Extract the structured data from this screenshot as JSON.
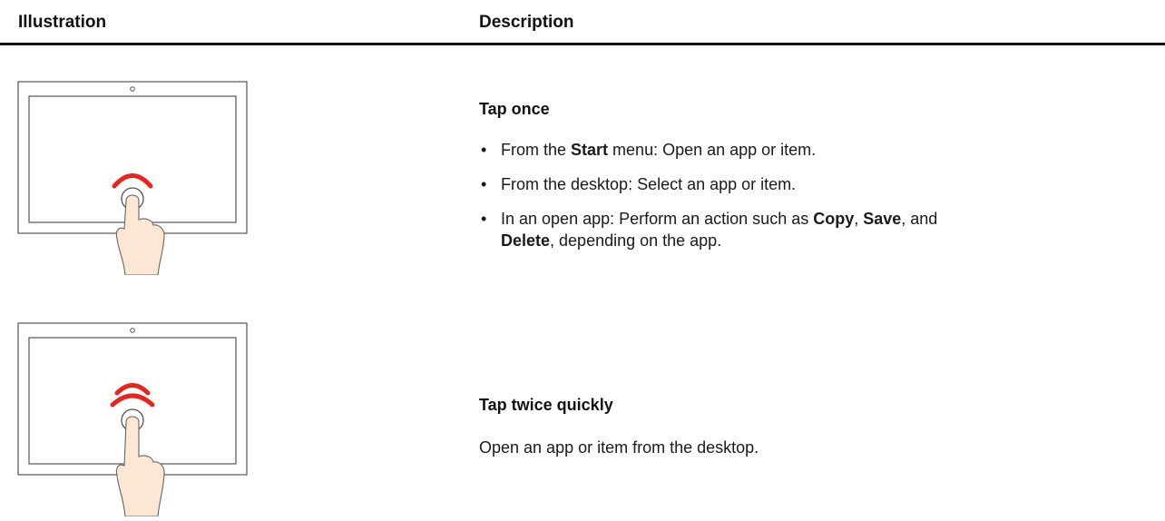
{
  "header": {
    "illustration": "Illustration",
    "description": "Description"
  },
  "colors": {
    "arc": "#e8241c",
    "skin": "#fbe7d4",
    "line": "#555555",
    "rule": "#111111"
  },
  "rows": [
    {
      "title": "Tap once",
      "tap_count": 1,
      "bullets": [
        {
          "parts": [
            {
              "text": "From the "
            },
            {
              "text": "Start",
              "bold": true
            },
            {
              "text": " menu: Open an app or item."
            }
          ]
        },
        {
          "parts": [
            {
              "text": "From the desktop: Select an app or item."
            }
          ]
        },
        {
          "parts": [
            {
              "text": "In an open app: Perform an action such as "
            },
            {
              "text": "Copy",
              "bold": true
            },
            {
              "text": ", "
            },
            {
              "text": "Save",
              "bold": true
            },
            {
              "text": ", and"
            },
            {
              "br": true
            },
            {
              "text": "Delete",
              "bold": true
            },
            {
              "text": ", depending on the app."
            }
          ]
        }
      ]
    },
    {
      "title": "Tap twice quickly",
      "tap_count": 2,
      "text": "Open an app or item from the desktop."
    }
  ]
}
